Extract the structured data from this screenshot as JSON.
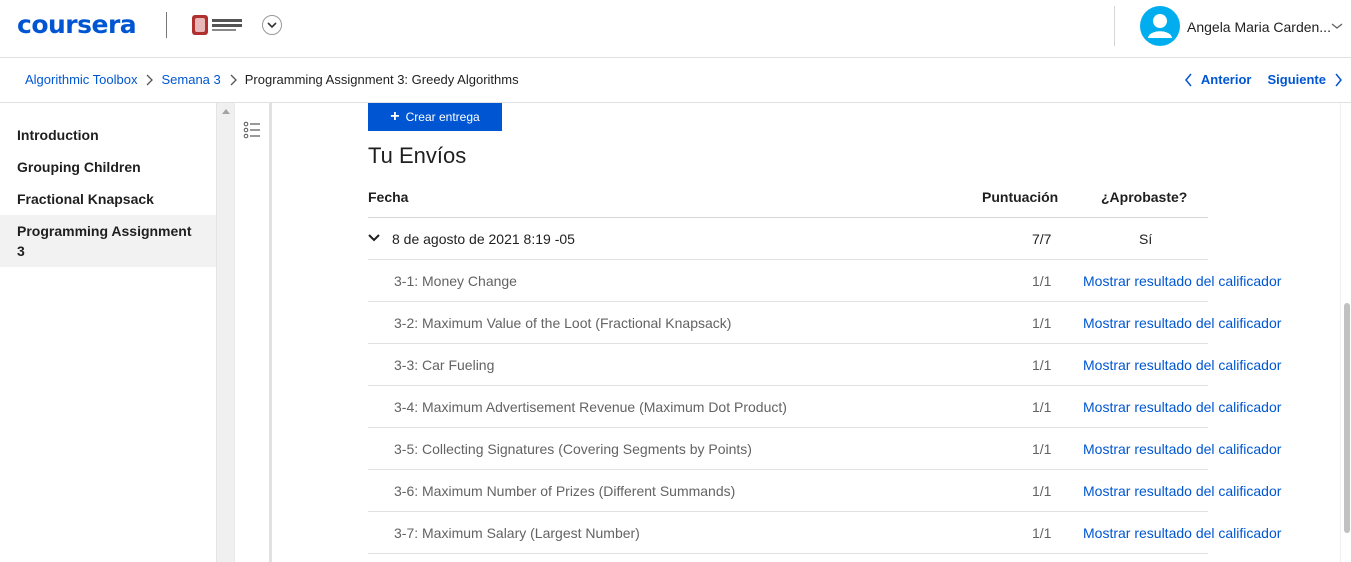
{
  "header": {
    "logo_text": "coursera",
    "university_logo": "universidad-nacional-de-colombia-logo",
    "user_name": "Angela Maria Carden...",
    "accent_color": "#0056d2",
    "avatar_color": "#00aeef"
  },
  "breadcrumb": {
    "items": [
      {
        "label": "Algorithmic Toolbox"
      },
      {
        "label": "Semana 3"
      },
      {
        "label": "Programming Assignment 3: Greedy Algorithms"
      }
    ]
  },
  "nav": {
    "prev_label": "Anterior",
    "next_label": "Siguiente"
  },
  "sidebar": {
    "items": [
      {
        "label": "Introduction"
      },
      {
        "label": "Grouping Children"
      },
      {
        "label": "Fractional Knapsack"
      },
      {
        "label": "Programming Assignment 3",
        "active": true
      }
    ]
  },
  "main": {
    "create_button_label": "Crear entrega",
    "title": "Tu Envíos",
    "columns": {
      "date": "Fecha",
      "score": "Puntuación",
      "passed": "¿Aprobaste?"
    },
    "submission": {
      "date": "8 de agosto de 2021 8:19 -05",
      "score": "7/7",
      "passed": "Sí"
    },
    "parts": [
      {
        "name": "3-1: Money Change",
        "score": "1/1",
        "link": "Mostrar resultado del calificador"
      },
      {
        "name": "3-2: Maximum Value of the Loot (Fractional Knapsack)",
        "score": "1/1",
        "link": "Mostrar resultado del calificador"
      },
      {
        "name": "3-3: Car Fueling",
        "score": "1/1",
        "link": "Mostrar resultado del calificador"
      },
      {
        "name": "3-4: Maximum Advertisement Revenue (Maximum Dot Product)",
        "score": "1/1",
        "link": "Mostrar resultado del calificador"
      },
      {
        "name": "3-5: Collecting Signatures (Covering Segments by Points)",
        "score": "1/1",
        "link": "Mostrar resultado del calificador"
      },
      {
        "name": "3-6: Maximum Number of Prizes (Different Summands)",
        "score": "1/1",
        "link": "Mostrar resultado del calificador"
      },
      {
        "name": "3-7: Maximum Salary (Largest Number)",
        "score": "1/1",
        "link": "Mostrar resultado del calificador"
      }
    ]
  }
}
